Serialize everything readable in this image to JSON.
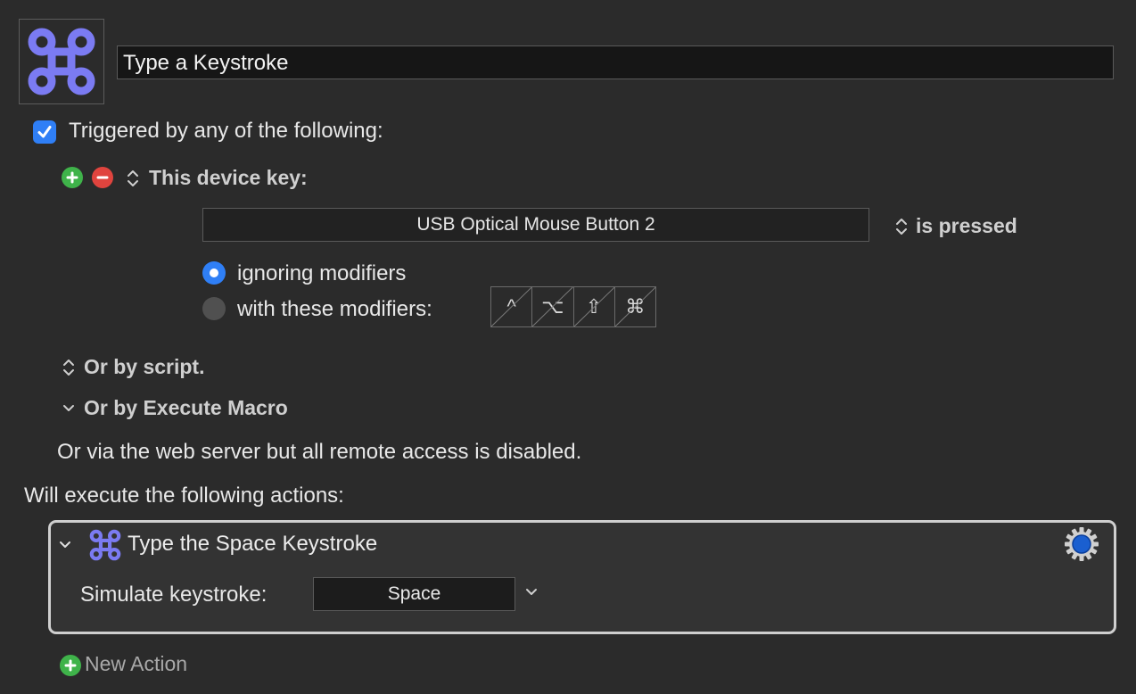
{
  "macro": {
    "icon": "command-key-icon",
    "name": "Type a Keystroke"
  },
  "trigger": {
    "enabled": true,
    "label": "Triggered by any of the following:",
    "device_key": {
      "label": "This device key:",
      "device": "USB Optical Mouse Button 2",
      "state": "is pressed",
      "modifier_options": [
        {
          "label": "ignoring modifiers",
          "selected": true
        },
        {
          "label": "with these modifiers:",
          "selected": false
        }
      ],
      "modifier_keys": [
        "^",
        "⌥",
        "⇧",
        "⌘"
      ]
    },
    "by_script": "Or by script.",
    "by_execute_macro": "Or by Execute Macro",
    "web_server": "Or via the web server but all remote access is disabled."
  },
  "actions": {
    "heading": "Will execute the following actions:",
    "items": [
      {
        "title": "Type the Space Keystroke",
        "icon": "command-key-icon",
        "field_label": "Simulate keystroke:",
        "keystroke": "Space"
      }
    ],
    "new_action_label": "New Action"
  },
  "colors": {
    "accent": "#2f7ff6",
    "icon_purple": "#7b7bf2",
    "plus_green": "#3fb34a",
    "minus_red": "#e0443e"
  }
}
